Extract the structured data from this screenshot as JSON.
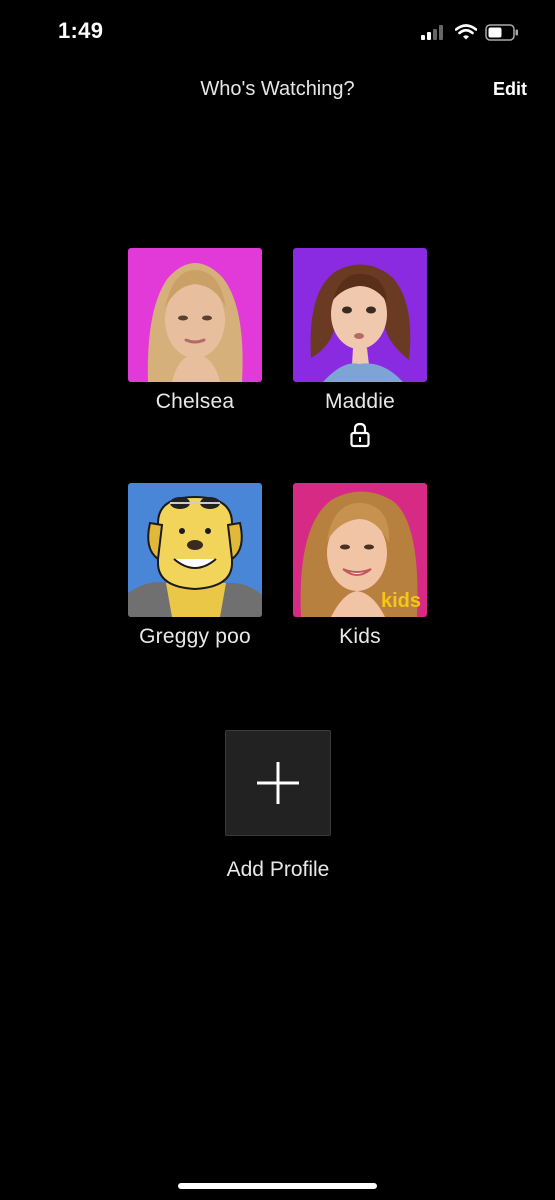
{
  "status_bar": {
    "time": "1:49",
    "icons": [
      "cellular-signal-icon",
      "wifi-icon",
      "battery-icon"
    ]
  },
  "header": {
    "title": "Who's Watching?",
    "edit_label": "Edit"
  },
  "profiles": [
    {
      "name": "Chelsea",
      "avatar_color": "#e23ad9",
      "locked": false
    },
    {
      "name": "Maddie",
      "avatar_color": "#8a2be2",
      "locked": true
    },
    {
      "name": "Greggy poo",
      "avatar_color": "#4a86d8",
      "locked": false
    },
    {
      "name": "Kids",
      "avatar_color": "#d62a84",
      "locked": false,
      "badge": "kids"
    }
  ],
  "add_profile": {
    "label": "Add Profile"
  },
  "colors": {
    "background": "#000000",
    "add_tile": "#222222",
    "kids_badge": "#f5c518"
  }
}
